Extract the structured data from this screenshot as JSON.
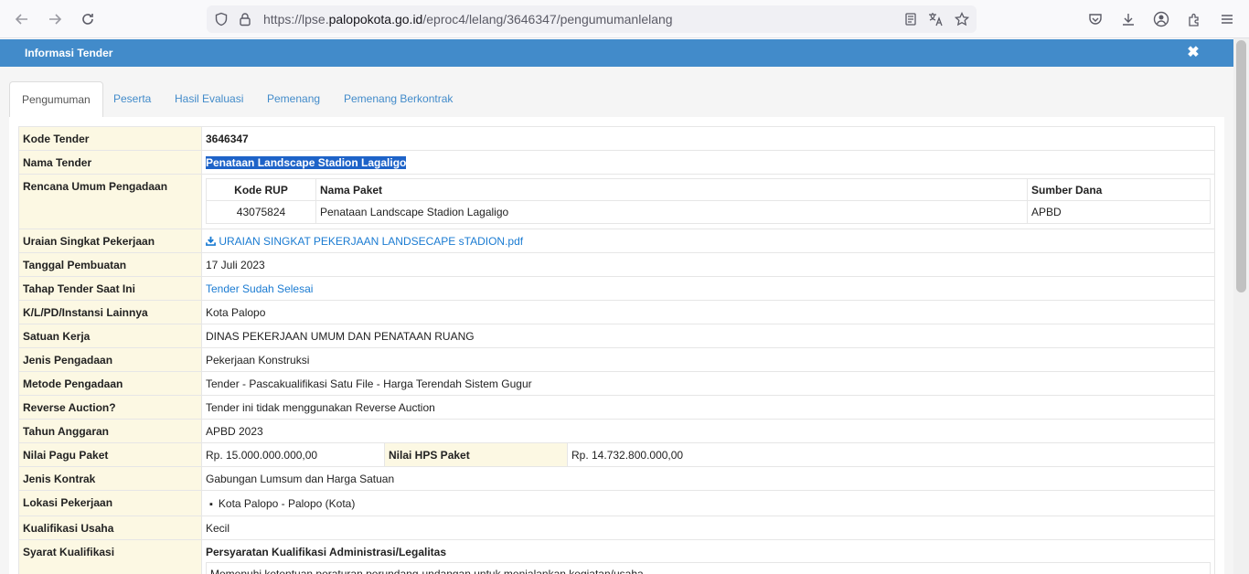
{
  "browser": {
    "url_prefix": "https://lpse.",
    "url_host": "palopokota.go.id",
    "url_path": "/eproc4/lelang/3646347/pengumumanlelang"
  },
  "modal": {
    "title": "Informasi Tender",
    "close_icon": "close-icon"
  },
  "tabs": [
    {
      "label": "Pengumuman",
      "active": true
    },
    {
      "label": "Peserta"
    },
    {
      "label": "Hasil Evaluasi"
    },
    {
      "label": "Pemenang"
    },
    {
      "label": "Pemenang Berkontrak"
    }
  ],
  "fields": {
    "kode_tender": {
      "label": "Kode Tender",
      "value": "3646347"
    },
    "nama_tender": {
      "label": "Nama Tender",
      "value": "Penataan Landscape Stadion Lagaligo"
    },
    "rup": {
      "label": "Rencana Umum Pengadaan",
      "headers": [
        "Kode RUP",
        "Nama Paket",
        "Sumber Dana"
      ],
      "row": [
        "43075824",
        "Penataan Landscape Stadion Lagaligo",
        "APBD"
      ]
    },
    "uraian": {
      "label": "Uraian Singkat Pekerjaan",
      "value": "URAIAN SINGKAT PEKERJAAN LANDSECAPE sTADION.pdf"
    },
    "tanggal": {
      "label": "Tanggal Pembuatan",
      "value": "17 Juli 2023"
    },
    "tahap": {
      "label": "Tahap Tender Saat Ini",
      "value": "Tender Sudah Selesai"
    },
    "klpd": {
      "label": "K/L/PD/Instansi Lainnya",
      "value": "Kota Palopo"
    },
    "satker": {
      "label": "Satuan Kerja",
      "value": "DINAS PEKERJAAN UMUM DAN PENATAAN RUANG"
    },
    "jenis_pengadaan": {
      "label": "Jenis Pengadaan",
      "value": "Pekerjaan Konstruksi"
    },
    "metode": {
      "label": "Metode Pengadaan",
      "value": "Tender - Pascakualifikasi Satu File - Harga Terendah Sistem Gugur"
    },
    "reverse": {
      "label": "Reverse Auction?",
      "value": "Tender ini tidak menggunakan Reverse Auction"
    },
    "tahun": {
      "label": "Tahun Anggaran",
      "value": "APBD 2023"
    },
    "pagu": {
      "label": "Nilai Pagu Paket",
      "value": "Rp. 15.000.000.000,00",
      "hps_label": "Nilai HPS Paket",
      "hps_value": "Rp. 14.732.800.000,00"
    },
    "kontrak": {
      "label": "Jenis Kontrak",
      "value": "Gabungan Lumsum dan Harga Satuan"
    },
    "lokasi": {
      "label": "Lokasi Pekerjaan",
      "value": "Kota Palopo - Palopo (Kota)"
    },
    "kualifikasi": {
      "label": "Kualifikasi Usaha",
      "value": "Kecil"
    },
    "syarat": {
      "label": "Syarat Kualifikasi",
      "heading": "Persyaratan Kualifikasi Administrasi/Legalitas",
      "item": "Memenuhi ketentuan peraturan perundang-undangan untuk menjalankan kegiatan/usaha."
    }
  }
}
